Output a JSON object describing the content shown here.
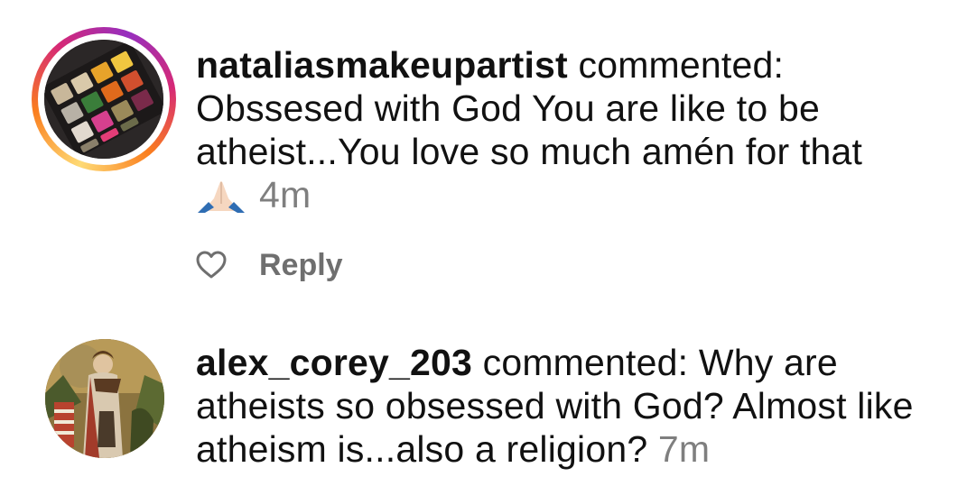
{
  "comments": [
    {
      "username": "nataliasmakeupartist",
      "verb": "commented:",
      "text_line1": "Obssesed with God You are like to be",
      "text_line2": "atheist...You love so much amén for that",
      "emoji_icon": "folded-hands-emoji",
      "time": "4m",
      "reply_label": "Reply",
      "has_story_ring": true
    },
    {
      "username": "alex_corey_203",
      "verb": "commented: Why are",
      "text_line1": "atheists so obsessed with God? Almost like",
      "text_line2": "atheism is...also a religion?",
      "time": "7m",
      "has_story_ring": false
    }
  ],
  "colors": {
    "text": "#111111",
    "timestamp": "#7f7f7f",
    "reply": "#6f6f6f",
    "story_ring_gradient": [
      "#feda75",
      "#fa7e1e",
      "#d62976",
      "#962fbf"
    ]
  }
}
